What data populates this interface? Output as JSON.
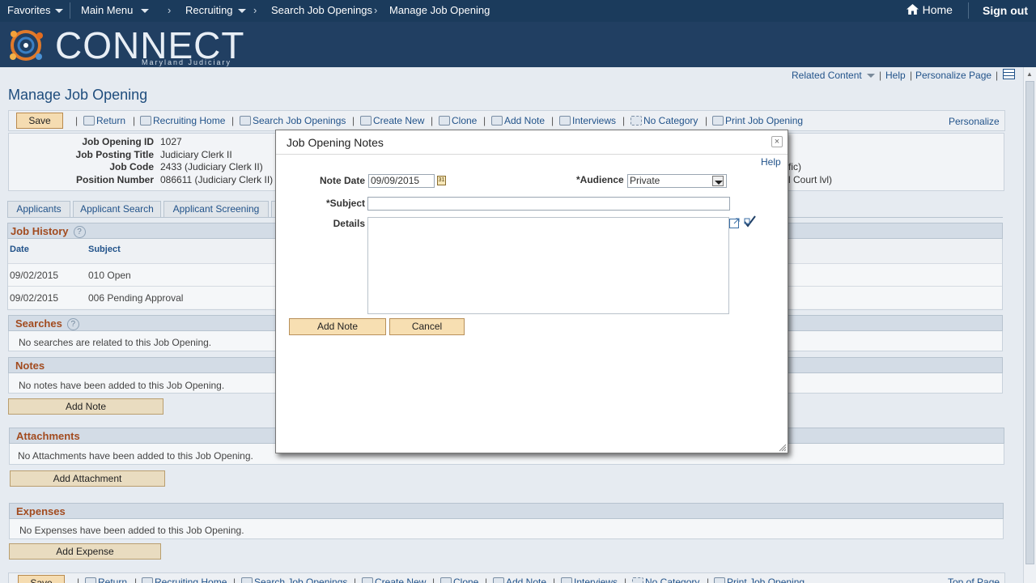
{
  "topnav": {
    "favorites": "Favorites",
    "main_menu": "Main Menu",
    "breadcrumb": [
      "Recruiting",
      "Search Job Openings",
      "Manage Job Opening"
    ],
    "home": "Home",
    "signout": "Sign out"
  },
  "banner": {
    "logo_text": "CONNECT",
    "logo_sub": "Maryland Judiciary"
  },
  "page": {
    "title": "Manage Job Opening",
    "related_content": "Related Content",
    "help": "Help",
    "personalize_page": "Personalize Page"
  },
  "toolbar": {
    "save": "Save",
    "return": "Return",
    "recruiting_home": "Recruiting Home",
    "search_job_openings": "Search Job Openings",
    "create_new": "Create New",
    "clone": "Clone",
    "add_note": "Add Note",
    "interviews": "Interviews",
    "no_category": "No Category",
    "print_job_opening": "Print Job Opening",
    "personalize": "Personalize",
    "top_of_page": "Top of Page"
  },
  "job_info": {
    "job_opening_id_label": "Job Opening ID",
    "job_opening_id": "1027",
    "job_posting_title_label": "Job Posting Title",
    "job_posting_title": "Judiciary Clerk II",
    "job_code_label": "Job Code",
    "job_code": "2433 (Judiciary Clerk II)",
    "position_number_label": "Position Number",
    "position_number": "086611 (Judiciary Clerk II)",
    "right_fragment_1": "fic)",
    "right_fragment_2": "l Court lvl)"
  },
  "tabs": [
    "Applicants",
    "Applicant Search",
    "Applicant Screening"
  ],
  "job_history": {
    "title": "Job History",
    "col_date": "Date",
    "col_subject": "Subject",
    "rows": [
      {
        "date": "09/02/2015",
        "subject": "010 Open"
      },
      {
        "date": "09/02/2015",
        "subject": "006 Pending Approval"
      }
    ]
  },
  "searches": {
    "title": "Searches",
    "message": "No searches are related to this Job Opening."
  },
  "notes": {
    "title": "Notes",
    "message": "No notes have been added to this Job Opening.",
    "button": "Add Note"
  },
  "attachments": {
    "title": "Attachments",
    "message": "No Attachments have been added to this Job Opening.",
    "button": "Add Attachment"
  },
  "expenses": {
    "title": "Expenses",
    "message": "No Expenses have been added to this Job Opening.",
    "button": "Add Expense"
  },
  "modal": {
    "title": "Job Opening Notes",
    "close": "×",
    "help": "Help",
    "note_date_label": "Note Date",
    "note_date": "09/09/2015",
    "audience_label": "*Audience",
    "audience": "Private",
    "subject_label": "*Subject",
    "subject_value": "",
    "details_label": "Details",
    "add_note_button": "Add Note",
    "cancel_button": "Cancel"
  },
  "colors": {
    "topbar": "#1b3b5c",
    "banner": "#213f62",
    "section_title": "#a24b1f",
    "link": "#22538a",
    "button": "#f5dcb1"
  }
}
